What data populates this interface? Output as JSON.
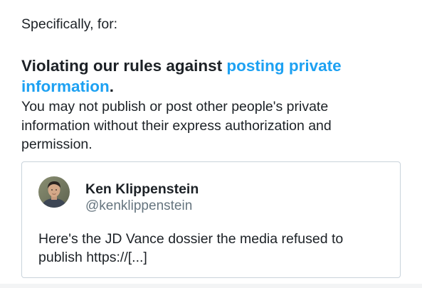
{
  "intro_text": "Specifically, for:",
  "rule": {
    "heading_prefix": "Violating our rules against ",
    "heading_link": "posting private information",
    "heading_suffix": ".",
    "description": "You may not publish or post other people's private information without their express authorization and permission."
  },
  "tweet": {
    "author_name": "Ken Klippenstein",
    "author_handle": "@kenklippenstein",
    "text": "Here's the JD Vance dossier the media refused to publish https://[...]",
    "avatar_alt": "Ken Klippenstein avatar"
  },
  "colors": {
    "link": "#1da1f2",
    "text": "#1c2126",
    "handle": "#66757f",
    "card_border": "#c9d3db"
  }
}
